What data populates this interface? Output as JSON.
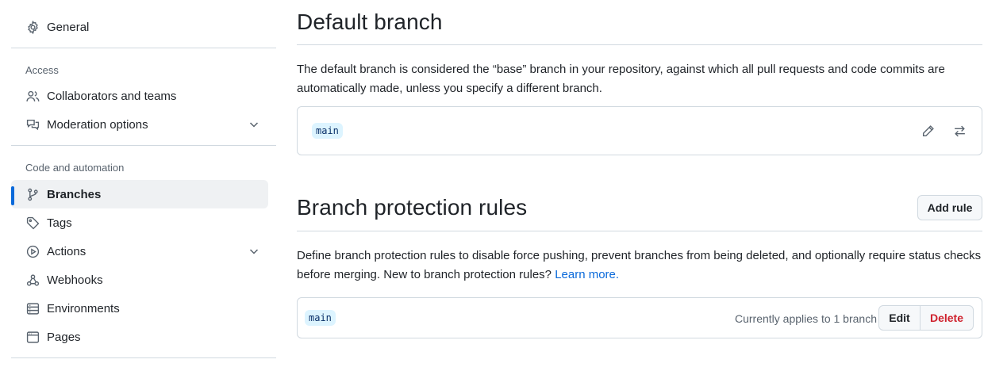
{
  "sidebar": {
    "general": "General",
    "access_heading": "Access",
    "collaborators": "Collaborators and teams",
    "moderation": "Moderation options",
    "code_heading": "Code and automation",
    "branches": "Branches",
    "tags": "Tags",
    "actions": "Actions",
    "webhooks": "Webhooks",
    "environments": "Environments",
    "pages": "Pages"
  },
  "default_branch": {
    "title": "Default branch",
    "description": "The default branch is considered the “base” branch in your repository, against which all pull requests and code commits are automatically made, unless you specify a different branch.",
    "branch": "main"
  },
  "protection": {
    "title": "Branch protection rules",
    "add_rule": "Add rule",
    "description": "Define branch protection rules to disable force pushing, prevent branches from being deleted, and optionally require status checks before merging. New to branch protection rules?",
    "learn_more": "Learn more.",
    "rule_branch": "main",
    "applies": "Currently applies to 1 branch",
    "edit": "Edit",
    "delete": "Delete"
  },
  "colors": {
    "accent": "#0969da",
    "danger": "#cf222e",
    "branch_tag_bg": "#ddf4ff"
  }
}
